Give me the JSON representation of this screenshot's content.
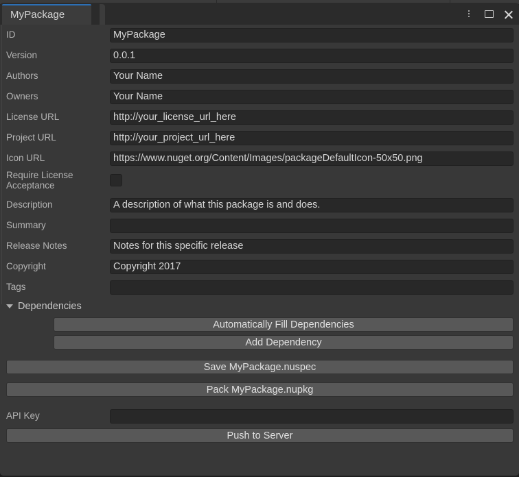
{
  "window": {
    "tab_label": "MyPackage",
    "tools": {
      "menu_icon": "kebab-menu-icon",
      "maximize_icon": "maximize-icon",
      "close_icon": "close-icon"
    },
    "accent_color": "#2c6fb5",
    "background_color": "#383838",
    "field_background": "#282828",
    "button_background": "#585858"
  },
  "form": {
    "fields": [
      {
        "label": "ID",
        "value": "MyPackage",
        "placeholder": ""
      },
      {
        "label": "Version",
        "value": "0.0.1",
        "placeholder": ""
      },
      {
        "label": "Authors",
        "value": "Your Name",
        "placeholder": ""
      },
      {
        "label": "Owners",
        "value": "Your Name",
        "placeholder": ""
      },
      {
        "label": "License URL",
        "value": "http://your_license_url_here",
        "placeholder": ""
      },
      {
        "label": "Project URL",
        "value": "http://your_project_url_here",
        "placeholder": ""
      },
      {
        "label": "Icon URL",
        "value": "https://www.nuget.org/Content/Images/packageDefaultIcon-50x50.png",
        "placeholder": ""
      }
    ],
    "require_license": {
      "label": "Require License Acceptance",
      "checked": false
    },
    "fields_after": [
      {
        "label": "Description",
        "value": "A description of what this package is and does.",
        "placeholder": ""
      },
      {
        "label": "Summary",
        "value": "",
        "placeholder": ""
      },
      {
        "label": "Release Notes",
        "value": "Notes for this specific release",
        "placeholder": ""
      },
      {
        "label": "Copyright",
        "value": "Copyright 2017",
        "placeholder": ""
      },
      {
        "label": "Tags",
        "value": "",
        "placeholder": ""
      }
    ]
  },
  "dependencies": {
    "title": "Dependencies",
    "expanded": true,
    "fill_button": "Automatically Fill Dependencies",
    "add_button": "Add Dependency"
  },
  "actions": {
    "save_button": "Save MyPackage.nuspec",
    "pack_button": "Pack MyPackage.nupkg",
    "push_button": "Push to Server"
  },
  "api_key": {
    "label": "API Key",
    "value": "",
    "placeholder": ""
  }
}
